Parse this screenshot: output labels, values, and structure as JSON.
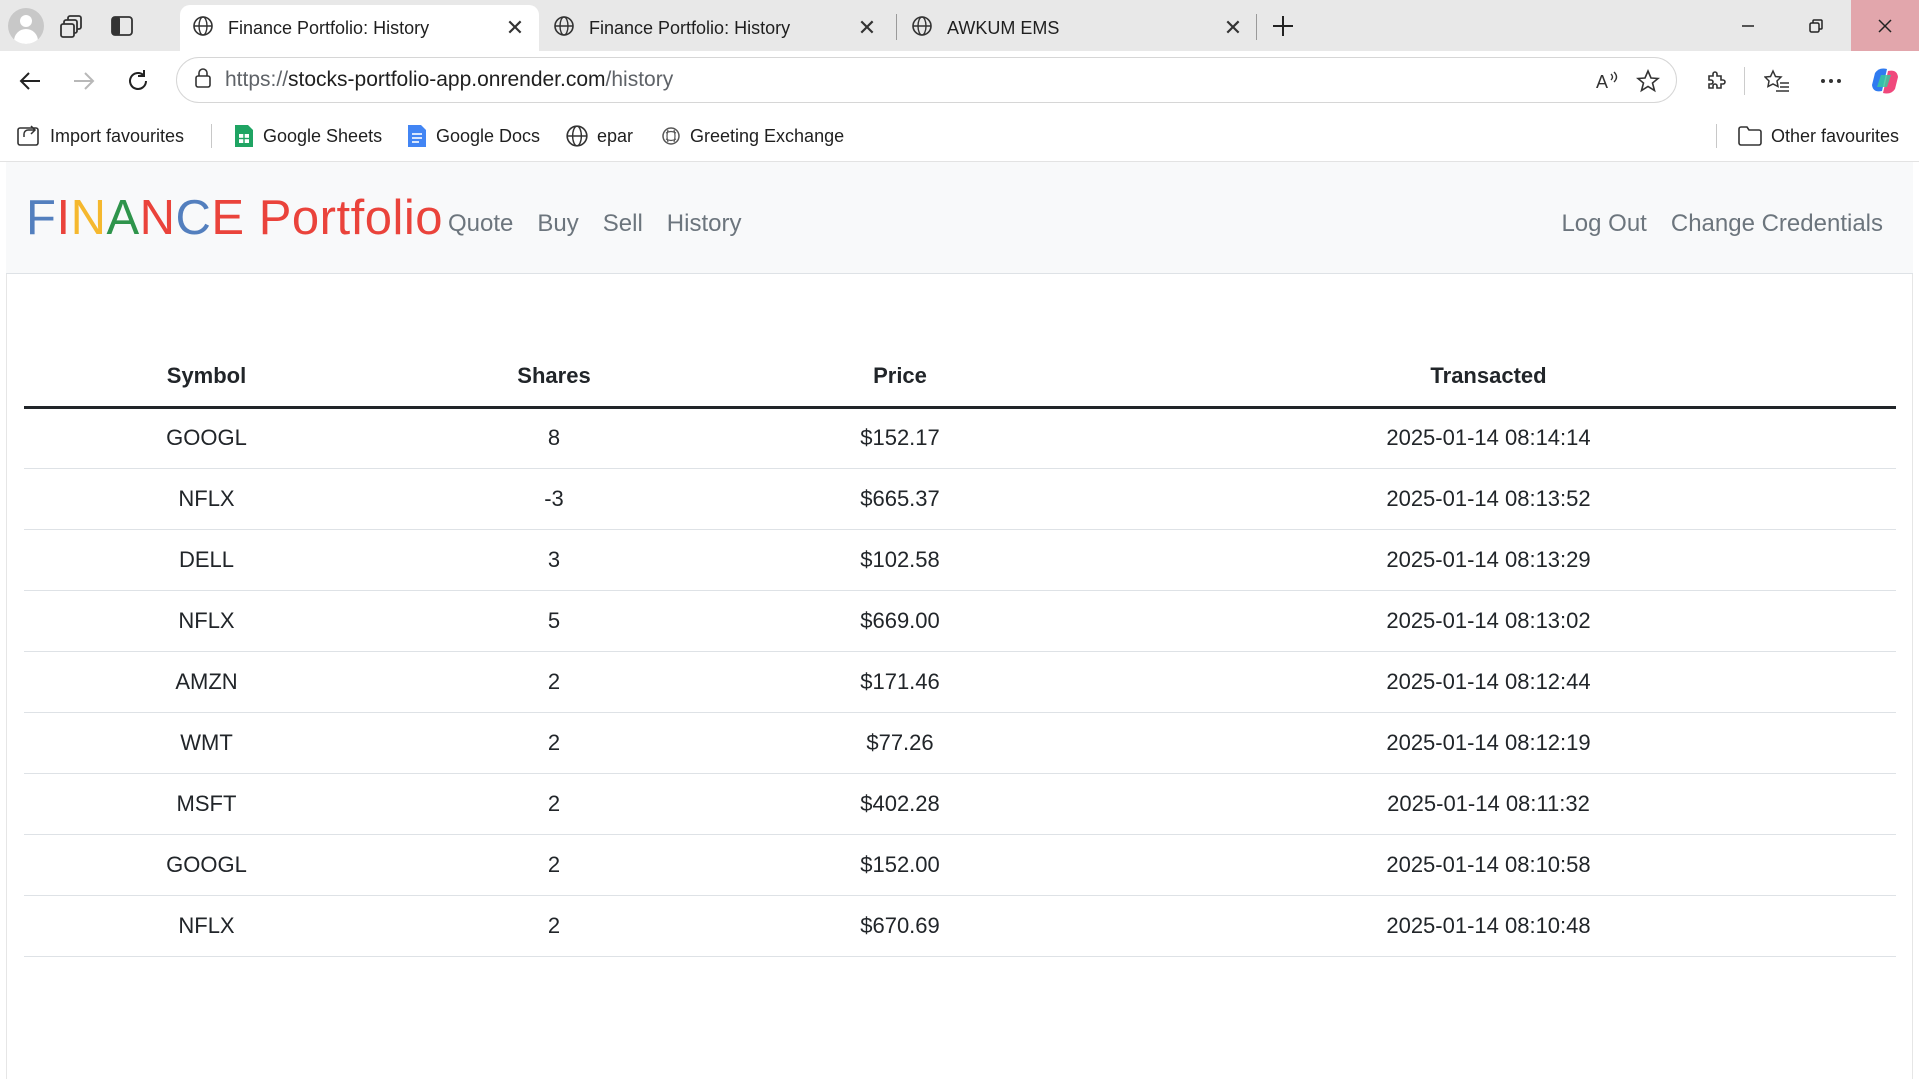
{
  "browser": {
    "tabs": [
      {
        "title": "Finance Portfolio: History",
        "active": true
      },
      {
        "title": "Finance Portfolio: History",
        "active": false
      },
      {
        "title": "AWKUM EMS",
        "active": false
      }
    ],
    "address": {
      "scheme": "https://",
      "host": "stocks-portfolio-app.onrender.com",
      "path": "/history"
    },
    "bookmarks": [
      {
        "label": "Import favourites",
        "icon": "import-icon"
      },
      {
        "label": "Google Sheets",
        "icon": "google-sheets-icon"
      },
      {
        "label": "Google Docs",
        "icon": "google-docs-icon"
      },
      {
        "label": "epar",
        "icon": "globe-icon"
      },
      {
        "label": "Greeting Exchange",
        "icon": "greeting-exchange-icon"
      }
    ],
    "other_favourites": "Other favourites"
  },
  "app": {
    "brand": {
      "letters": [
        {
          "ch": "F",
          "color": "#537fbe"
        },
        {
          "ch": "I",
          "color": "#ea433b"
        },
        {
          "ch": "N",
          "color": "#f5b82e"
        },
        {
          "ch": "A",
          "color": "#2e944b"
        },
        {
          "ch": "N",
          "color": "#ea433b"
        },
        {
          "ch": "C",
          "color": "#537fbe"
        },
        {
          "ch": "E",
          "color": "#ea433b"
        }
      ],
      "suffix": "Portfolio",
      "suffix_color": "#ea433b"
    },
    "nav": {
      "quote": "Quote",
      "buy": "Buy",
      "sell": "Sell",
      "history": "History"
    },
    "nav_right": {
      "logout": "Log Out",
      "change_credentials": "Change Credentials"
    }
  },
  "history_table": {
    "headers": [
      "Symbol",
      "Shares",
      "Price",
      "Transacted"
    ],
    "rows": [
      [
        "GOOGL",
        "8",
        "$152.17",
        "2025-01-14 08:14:14"
      ],
      [
        "NFLX",
        "-3",
        "$665.37",
        "2025-01-14 08:13:52"
      ],
      [
        "DELL",
        "3",
        "$102.58",
        "2025-01-14 08:13:29"
      ],
      [
        "NFLX",
        "5",
        "$669.00",
        "2025-01-14 08:13:02"
      ],
      [
        "AMZN",
        "2",
        "$171.46",
        "2025-01-14 08:12:44"
      ],
      [
        "WMT",
        "2",
        "$77.26",
        "2025-01-14 08:12:19"
      ],
      [
        "MSFT",
        "2",
        "$402.28",
        "2025-01-14 08:11:32"
      ],
      [
        "GOOGL",
        "2",
        "$152.00",
        "2025-01-14 08:10:58"
      ],
      [
        "NFLX",
        "2",
        "$670.69",
        "2025-01-14 08:10:48"
      ]
    ]
  }
}
